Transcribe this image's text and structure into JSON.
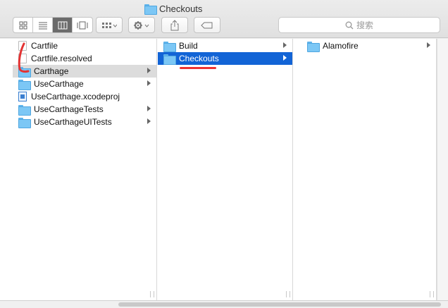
{
  "window": {
    "title": "Checkouts"
  },
  "toolbar": {
    "view_icons": [
      "icon-view-icon",
      "list-view-icon",
      "column-view-icon",
      "gallery-view-icon"
    ],
    "arrange_icon": "grid-icon",
    "action_icon": "gear-icon",
    "share_icon": "share-icon",
    "tag_icon": "tag-icon",
    "search_placeholder": "搜索"
  },
  "columns": [
    {
      "items": [
        {
          "name": "Cartfile",
          "kind": "file",
          "has_children": false
        },
        {
          "name": "Cartfile.resolved",
          "kind": "file",
          "has_children": false
        },
        {
          "name": "Carthage",
          "kind": "folder",
          "has_children": true,
          "selected": "grey"
        },
        {
          "name": "UseCarthage",
          "kind": "folder",
          "has_children": true
        },
        {
          "name": "UseCarthage.xcodeproj",
          "kind": "project",
          "has_children": false
        },
        {
          "name": "UseCarthageTests",
          "kind": "folder",
          "has_children": true
        },
        {
          "name": "UseCarthageUITests",
          "kind": "folder",
          "has_children": true
        }
      ]
    },
    {
      "items": [
        {
          "name": "Build",
          "kind": "folder",
          "has_children": true
        },
        {
          "name": "Checkouts",
          "kind": "folder",
          "has_children": true,
          "selected": "blue"
        }
      ]
    },
    {
      "items": [
        {
          "name": "Alamofire",
          "kind": "folder",
          "has_children": true
        }
      ]
    }
  ],
  "colors": {
    "selection_blue": "#1264d6",
    "selection_grey": "#dcdcdc",
    "annotation_red": "#e33333"
  }
}
